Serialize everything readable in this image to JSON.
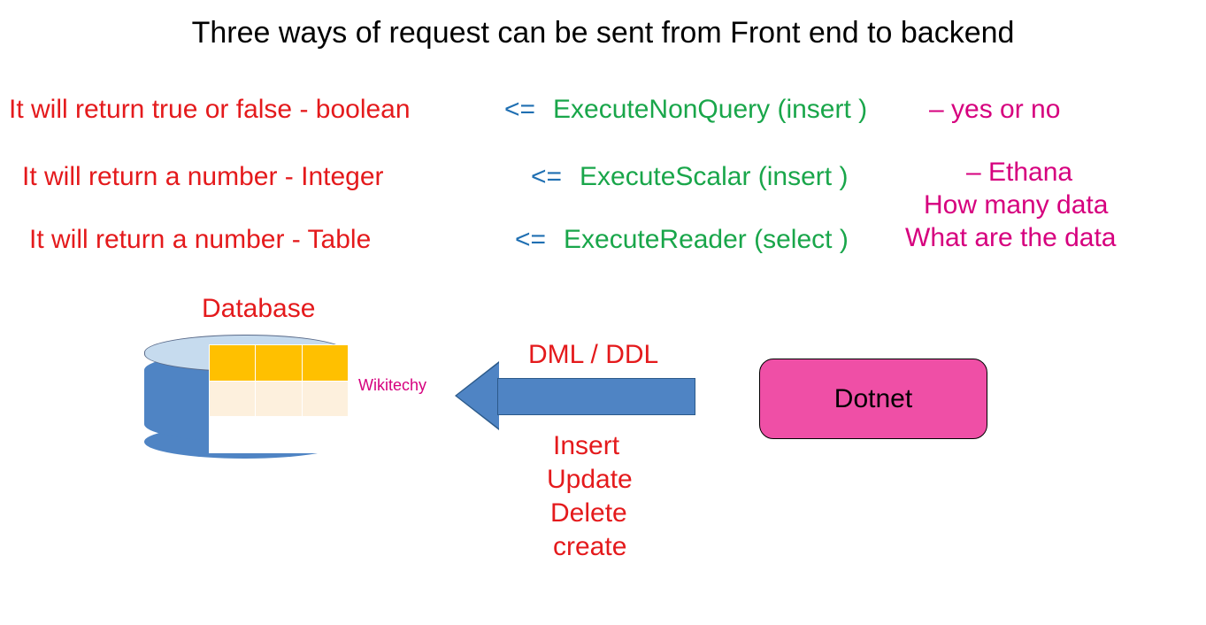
{
  "title": "Three ways of request can be sent from Front end to backend",
  "rows": [
    {
      "ret": "It will return true or false - boolean",
      "arrow": "<=",
      "exec": "ExecuteNonQuery (insert )",
      "note": "– yes or no"
    },
    {
      "ret": "It will return a number - Integer",
      "arrow": "<=",
      "exec": "ExecuteScalar (insert )",
      "note": "– Ethana"
    },
    {
      "ret": "It will return a number - Table",
      "arrow": "<=",
      "exec": "ExecuteReader (select )",
      "note": "What are the data"
    }
  ],
  "extra_note": "How many data",
  "db_label": "Database",
  "dml_label": "DML / DDL",
  "ops": [
    "Insert",
    "Update",
    "Delete",
    "create"
  ],
  "dotnet": "Dotnet",
  "watermark": "Wikitechy"
}
